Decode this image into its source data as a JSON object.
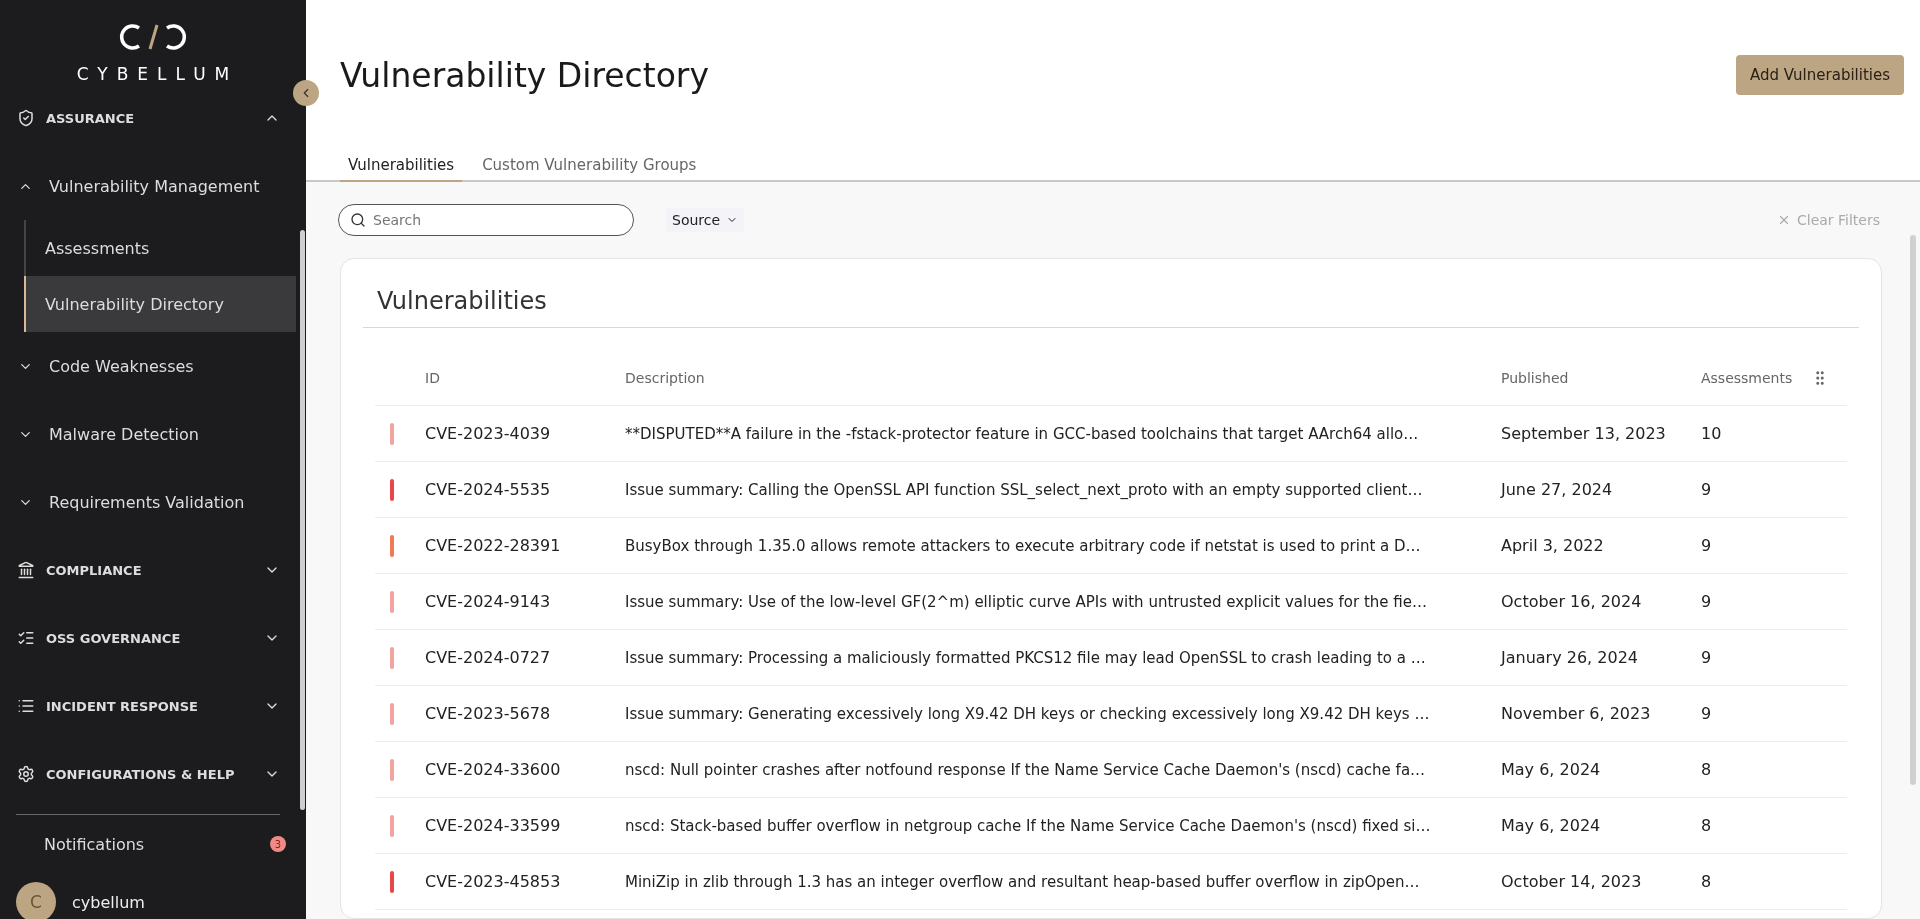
{
  "sidebar": {
    "brand": "CYBELLUM",
    "items": [
      {
        "kind": "section",
        "label": "ASSURANCE",
        "expanded": true,
        "children": [
          {
            "kind": "group",
            "label": "Vulnerability Management",
            "expanded": true,
            "children": [
              {
                "kind": "sub",
                "label": "Assessments",
                "selected": false
              },
              {
                "kind": "sub",
                "label": "Vulnerability Directory",
                "selected": true
              }
            ]
          },
          {
            "kind": "group",
            "label": "Code Weaknesses",
            "expanded": false
          },
          {
            "kind": "group",
            "label": "Malware Detection",
            "expanded": false
          },
          {
            "kind": "group",
            "label": "Requirements Validation",
            "expanded": false
          }
        ]
      },
      {
        "kind": "section",
        "label": "COMPLIANCE",
        "expanded": false
      },
      {
        "kind": "section",
        "label": "OSS GOVERNANCE",
        "expanded": false
      },
      {
        "kind": "section",
        "label": "INCIDENT RESPONSE",
        "expanded": false
      },
      {
        "kind": "section",
        "label": "CONFIGURATIONS & HELP",
        "expanded": false
      }
    ],
    "notifications": {
      "label": "Notifications",
      "count": "3"
    },
    "user": {
      "initial": "C",
      "name": "cybellum"
    }
  },
  "page": {
    "title": "Vulnerability Directory",
    "action": "Add Vulnerabilities"
  },
  "tabs": [
    {
      "label": "Vulnerabilities",
      "selected": true
    },
    {
      "label": "Custom Vulnerability Groups",
      "selected": false
    }
  ],
  "filters": {
    "search": {
      "placeholder": "Search"
    },
    "source": "Source",
    "clear": "Clear Filters"
  },
  "card": {
    "title": "Vulnerabilities",
    "columns": [
      "ID",
      "Description",
      "Published",
      "Assessments"
    ],
    "rows": [
      {
        "color": "#f4a3a0",
        "id": "CVE-2023-4039",
        "description": "**DISPUTED**A failure in the -fstack-protector feature in GCC-based toolchains that target AArch64 allo…",
        "published": "September 13, 2023",
        "assessments": "10"
      },
      {
        "color": "#e8474a",
        "id": "CVE-2024-5535",
        "description": "Issue summary: Calling the OpenSSL API function SSL_select_next_proto with an empty supported client…",
        "published": "June 27, 2024",
        "assessments": "9"
      },
      {
        "color": "#f07a52",
        "id": "CVE-2022-28391",
        "description": "BusyBox through 1.35.0 allows remote attackers to execute arbitrary code if netstat is used to print a D…",
        "published": "April 3, 2022",
        "assessments": "9"
      },
      {
        "color": "#f4a3a0",
        "id": "CVE-2024-9143",
        "description": "Issue summary: Use of the low-level GF(2^m) elliptic curve APIs with untrusted explicit values for the fie…",
        "published": "October 16, 2024",
        "assessments": "9"
      },
      {
        "color": "#f4a3a0",
        "id": "CVE-2024-0727",
        "description": "Issue summary: Processing a maliciously formatted PKCS12 file may lead OpenSSL to crash leading to a …",
        "published": "January 26, 2024",
        "assessments": "9"
      },
      {
        "color": "#f4a3a0",
        "id": "CVE-2023-5678",
        "description": "Issue summary: Generating excessively long X9.42 DH keys or checking excessively long X9.42 DH keys …",
        "published": "November 6, 2023",
        "assessments": "9"
      },
      {
        "color": "#f4a3a0",
        "id": "CVE-2024-33600",
        "description": "nscd: Null pointer crashes after notfound response If the Name Service Cache Daemon's (nscd) cache fa…",
        "published": "May 6, 2024",
        "assessments": "8"
      },
      {
        "color": "#f4a3a0",
        "id": "CVE-2024-33599",
        "description": "nscd: Stack-based buffer overflow in netgroup cache If the Name Service Cache Daemon's (nscd) fixed si…",
        "published": "May 6, 2024",
        "assessments": "8"
      },
      {
        "color": "#e8474a",
        "id": "CVE-2023-45853",
        "description": "MiniZip in zlib through 1.3 has an integer overflow and resultant heap-based buffer overflow in zipOpen…",
        "published": "October 14, 2023",
        "assessments": "8"
      }
    ]
  }
}
